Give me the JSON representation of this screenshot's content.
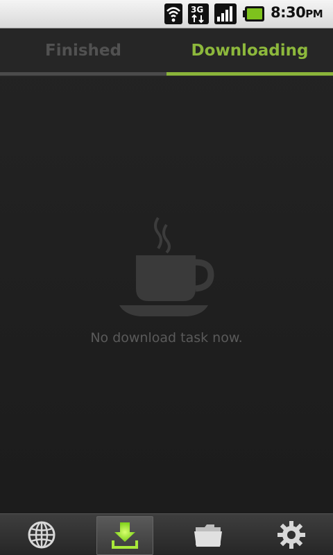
{
  "status_bar": {
    "time": "8:30",
    "ampm": "PM",
    "network_type": "3G",
    "icons": [
      "wifi-icon",
      "3g-data-icon",
      "signal-strength-icon",
      "battery-icon"
    ]
  },
  "tabs": [
    {
      "label": "Finished",
      "active": false
    },
    {
      "label": "Downloading",
      "active": true
    }
  ],
  "empty_state": {
    "icon": "coffee-cup-icon",
    "message": "No download task now."
  },
  "bottom_nav": [
    {
      "icon": "globe-icon",
      "active": false
    },
    {
      "icon": "download-icon",
      "active": true
    },
    {
      "icon": "folder-icon",
      "active": false
    },
    {
      "icon": "gear-icon",
      "active": false
    }
  ],
  "colors": {
    "accent": "#8db83c",
    "background": "#222222",
    "inactive_text": "#515151",
    "empty_text": "#5a5a5a"
  }
}
